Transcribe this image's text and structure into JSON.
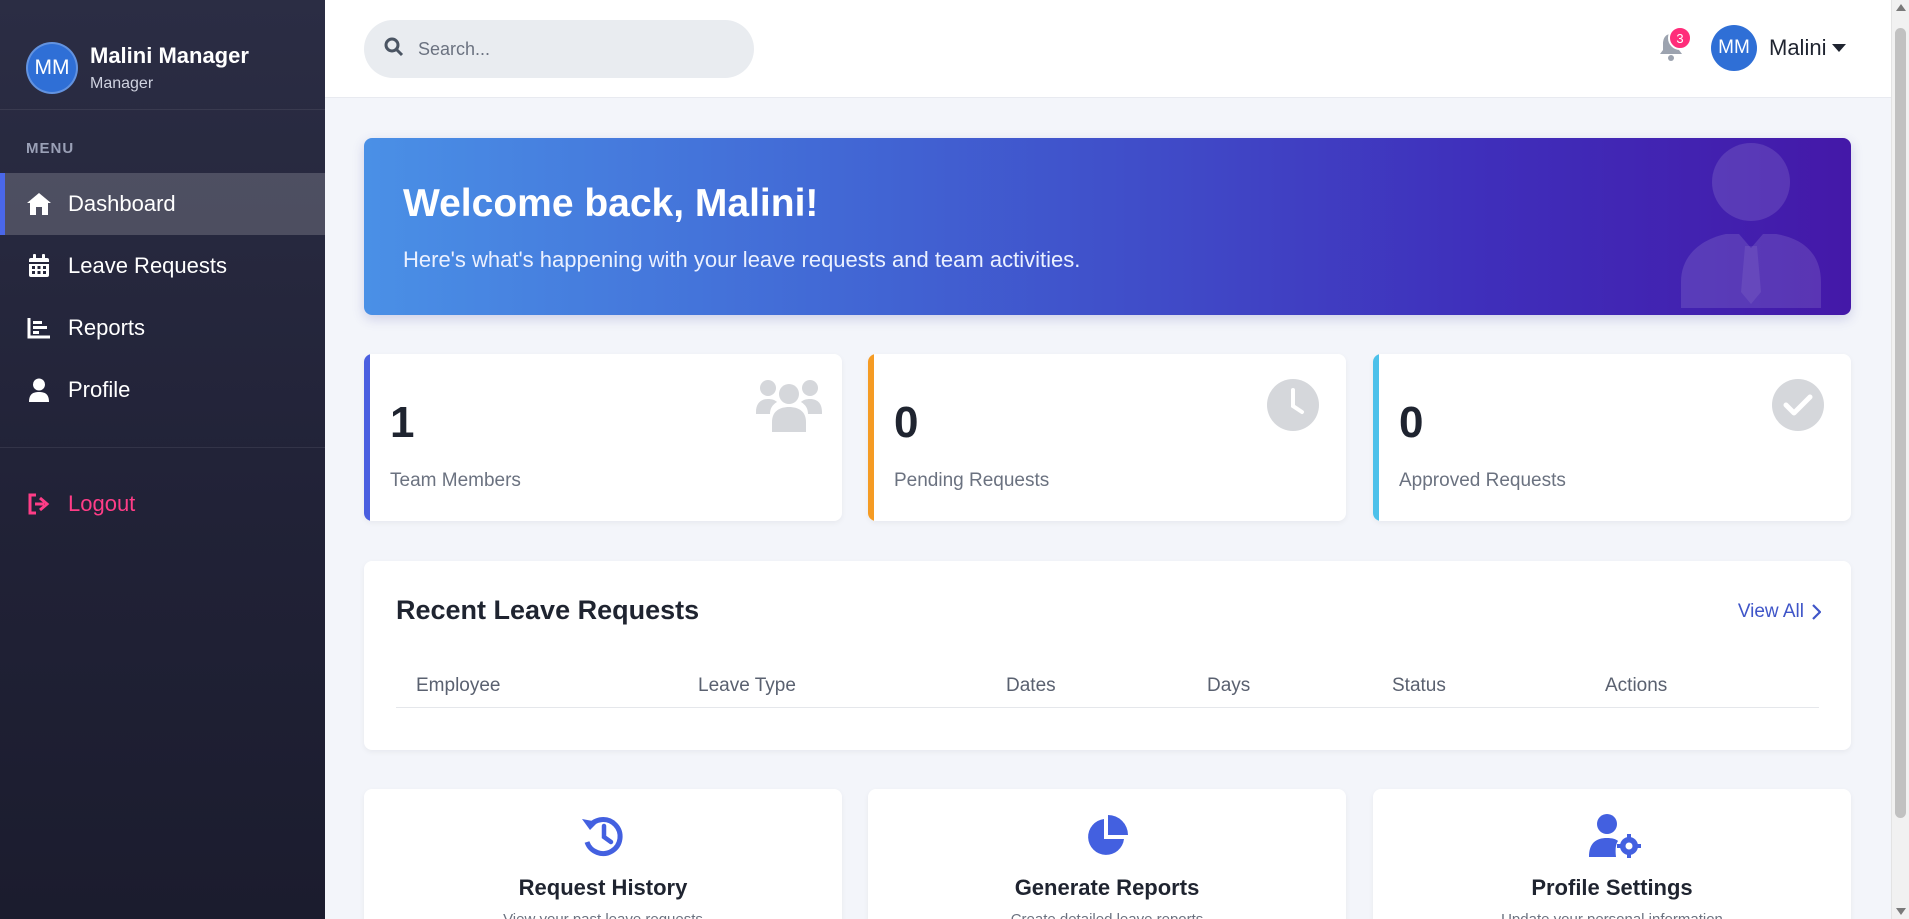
{
  "sidebar": {
    "user": {
      "initials": "MM",
      "name": "Malini Manager",
      "role": "Manager"
    },
    "menu_title": "MENU",
    "items": [
      {
        "label": "Dashboard",
        "icon": "home-icon",
        "active": true
      },
      {
        "label": "Leave Requests",
        "icon": "calendar-icon",
        "active": false
      },
      {
        "label": "Reports",
        "icon": "chart-icon",
        "active": false
      },
      {
        "label": "Profile",
        "icon": "user-icon",
        "active": false
      }
    ],
    "logout_label": "Logout"
  },
  "topbar": {
    "search_placeholder": "Search...",
    "notification_count": "3",
    "user_initials": "MM",
    "user_name": "Malini"
  },
  "welcome": {
    "title": "Welcome back, Malini!",
    "subtitle": "Here's what's happening with your leave requests and team activities."
  },
  "stats": [
    {
      "value": "1",
      "label": "Team Members",
      "icon": "users-icon",
      "accent": "#4a5fe0"
    },
    {
      "value": "0",
      "label": "Pending Requests",
      "icon": "clock-icon",
      "accent": "#f59b23"
    },
    {
      "value": "0",
      "label": "Approved Requests",
      "icon": "check-circle-icon",
      "accent": "#4cc1ea"
    }
  ],
  "recent": {
    "title": "Recent Leave Requests",
    "view_all": "View All",
    "columns": [
      "Employee",
      "Leave Type",
      "Dates",
      "Days",
      "Status",
      "Actions"
    ]
  },
  "quick_actions": [
    {
      "title": "Request History",
      "icon": "history-icon",
      "description": "View your past leave requests"
    },
    {
      "title": "Generate Reports",
      "icon": "pie-chart-icon",
      "description": "Create detailed leave reports"
    },
    {
      "title": "Profile Settings",
      "icon": "user-cog-icon",
      "description": "Update your personal information"
    }
  ],
  "colors": {
    "accent": "#4a5fe0",
    "logout": "#ff3d87",
    "badge": "#ff2d7a",
    "avatar": "#2f6fd6"
  }
}
